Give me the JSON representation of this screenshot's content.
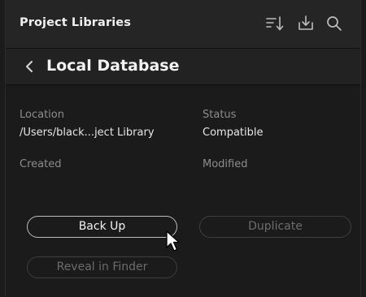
{
  "header": {
    "title": "Project Libraries",
    "icons": [
      "sort-icon",
      "import-icon",
      "search-icon"
    ]
  },
  "database": {
    "title": "Local Database"
  },
  "details": {
    "location_label": "Location",
    "location_value": "/Users/black...ject Library",
    "status_label": "Status",
    "status_value": "Compatible",
    "created_label": "Created",
    "modified_label": "Modified"
  },
  "buttons": {
    "backup": "Back Up",
    "duplicate": "Duplicate",
    "reveal": "Reveal in Finder"
  },
  "colors": {
    "background": "#1b1b1b",
    "header": "#252525",
    "text_primary": "#f0f0f0",
    "text_label": "#8d8d8d",
    "text_disabled": "#6c6c6c"
  }
}
